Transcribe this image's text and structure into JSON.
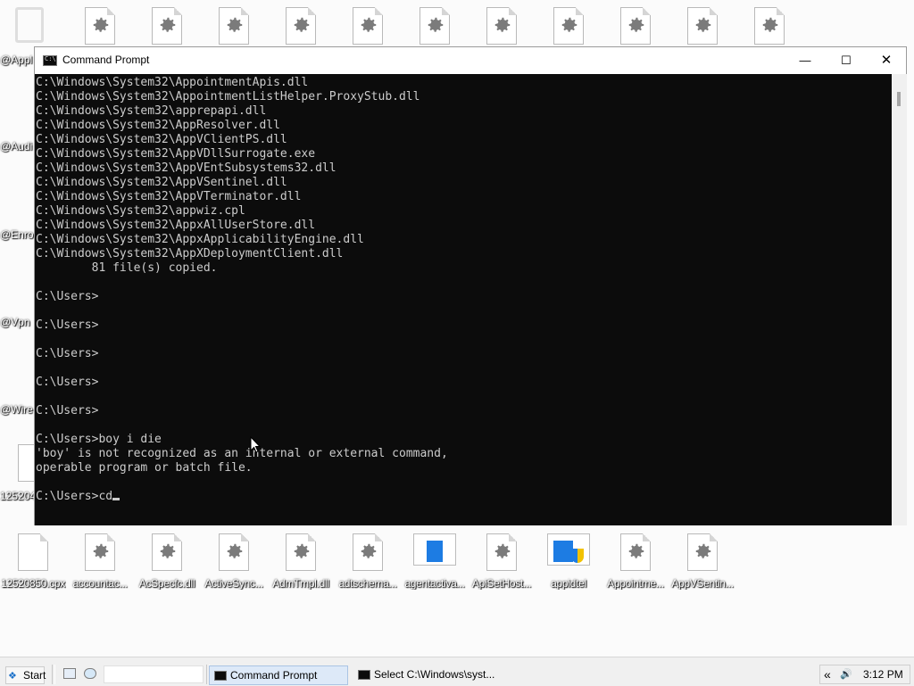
{
  "desktop": {
    "left_labels": [
      "@Appl",
      "@Audi",
      "@Enro",
      "@Vpn",
      "@Wire",
      "125204"
    ],
    "bottom_icons": [
      {
        "label": "12520850.cpx",
        "type": "blank"
      },
      {
        "label": "accountac...",
        "type": "gear"
      },
      {
        "label": "AcSpecfc.dll",
        "type": "gear"
      },
      {
        "label": "ActiveSync...",
        "type": "gear"
      },
      {
        "label": "AdmTmpl.dll",
        "type": "gear"
      },
      {
        "label": "adtschema...",
        "type": "gear"
      },
      {
        "label": "agentactiva...",
        "type": "thumb"
      },
      {
        "label": "ApiSetHost...",
        "type": "gear"
      },
      {
        "label": "appidtel",
        "type": "shield"
      },
      {
        "label": "Appointme...",
        "type": "gear"
      },
      {
        "label": "AppVSentin...",
        "type": "gear"
      }
    ]
  },
  "window": {
    "title": "Command Prompt",
    "minimize_glyph": "—",
    "maximize_glyph": "☐",
    "close_glyph": "✕"
  },
  "console": {
    "lines": [
      "C:\\Windows\\System32\\AppointmentApis.dll",
      "C:\\Windows\\System32\\AppointmentListHelper.ProxyStub.dll",
      "C:\\Windows\\System32\\apprepapi.dll",
      "C:\\Windows\\System32\\AppResolver.dll",
      "C:\\Windows\\System32\\AppVClientPS.dll",
      "C:\\Windows\\System32\\AppVDllSurrogate.exe",
      "C:\\Windows\\System32\\AppVEntSubsystems32.dll",
      "C:\\Windows\\System32\\AppVSentinel.dll",
      "C:\\Windows\\System32\\AppVTerminator.dll",
      "C:\\Windows\\System32\\appwiz.cpl",
      "C:\\Windows\\System32\\AppxAllUserStore.dll",
      "C:\\Windows\\System32\\AppxApplicabilityEngine.dll",
      "C:\\Windows\\System32\\AppXDeploymentClient.dll",
      "        81 file(s) copied.",
      "",
      "C:\\Users>",
      "",
      "C:\\Users>",
      "",
      "C:\\Users>",
      "",
      "C:\\Users>",
      "",
      "C:\\Users>",
      "",
      "C:\\Users>boy i die",
      "'boy' is not recognized as an internal or external command,",
      "operable program or batch file.",
      ""
    ],
    "prompt": "C:\\Users>",
    "current_input": "cd"
  },
  "taskbar": {
    "start_label": "Start",
    "tasks": [
      {
        "label": "Command Prompt"
      },
      {
        "label": "Select C:\\Windows\\syst..."
      }
    ],
    "tray_chevron": "«",
    "clock": "3:12 PM"
  },
  "colors": {
    "console_bg": "#0c0c0c",
    "console_fg": "#cccccc",
    "taskbar_bg": "#f0f0f0",
    "active_task": "#dde9f8"
  }
}
